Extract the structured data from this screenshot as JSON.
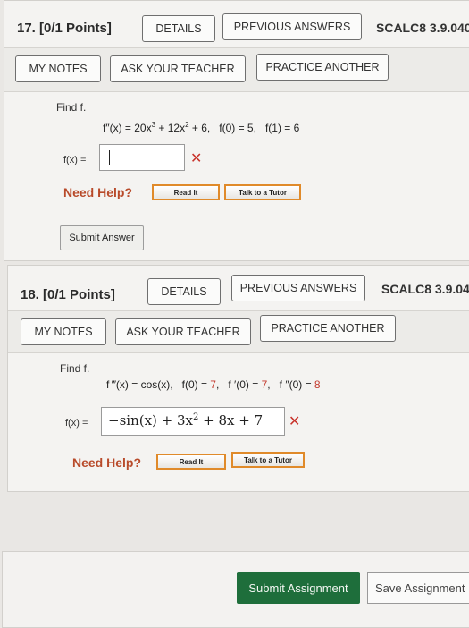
{
  "questions": [
    {
      "number": "17.",
      "points": "[0/1 Points]",
      "details": "DETAILS",
      "previous_answers": "PREVIOUS ANSWERS",
      "code": "SCALC8 3.9.040",
      "my_notes": "MY NOTES",
      "ask_teacher": "ASK YOUR TEACHER",
      "practice_another": "PRACTICE ANOTHER",
      "prompt": "Find f.",
      "equation": {
        "lhs": "f″(x) = 20x",
        "exp1": "3",
        "mid": " + 12x",
        "exp2": "2",
        "tail": " + 6,",
        "c1": "f(0) = 5,",
        "c2": "f(1) = 6"
      },
      "answer_label": "f(x) =",
      "answer_value": "",
      "need_help": "Need Help?",
      "read_it": "Read It",
      "talk_tutor": "Talk to a Tutor",
      "submit_answer": "Submit Answer"
    },
    {
      "number": "18.",
      "points": "[0/1 Points]",
      "details": "DETAILS",
      "previous_answers": "PREVIOUS ANSWERS",
      "code": "SCALC8 3.9.04",
      "my_notes": "MY NOTES",
      "ask_teacher": "ASK YOUR TEACHER",
      "practice_another": "PRACTICE ANOTHER",
      "prompt": "Find f.",
      "equation": {
        "lhs": "f ‴(x) = cos(x),",
        "c1a": "f(0) = ",
        "c1b": "7",
        "c1c": ",",
        "c2a": "f ′(0) = ",
        "c2b": "7",
        "c2c": ",",
        "c3a": "f ″(0) = ",
        "c3b": "8"
      },
      "answer_label": "f(x) =",
      "answer_math_a": "−sin(x) + 3x",
      "answer_math_exp": "2",
      "answer_math_b": " + 8x + 7",
      "need_help": "Need Help?",
      "read_it": "Read It",
      "talk_tutor": "Talk to a Tutor"
    }
  ],
  "footer": {
    "submit_assignment": "Submit Assignment",
    "save_assignment": "Save Assignment"
  },
  "colors": {
    "wrong_mark": "#c8322a",
    "help_text": "#b84a2a",
    "submit_green": "#1e6e3b",
    "tutor_border": "#e08a2a"
  }
}
